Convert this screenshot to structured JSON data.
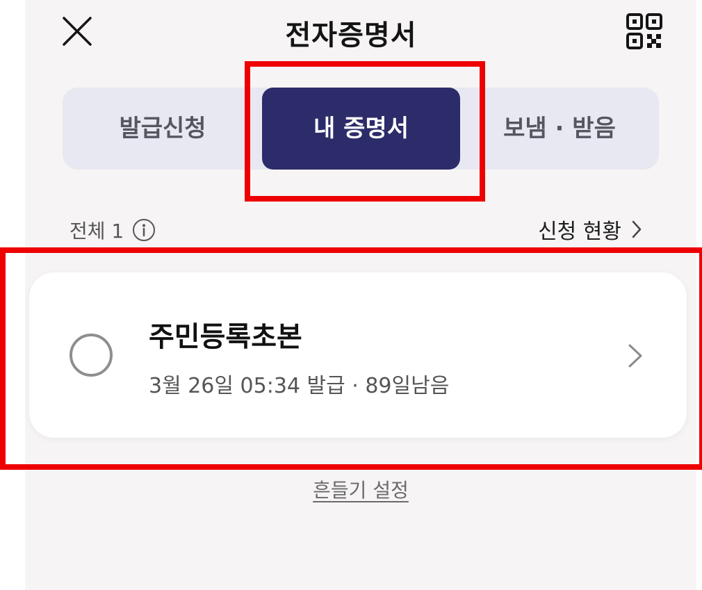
{
  "header": {
    "title": "전자증명서",
    "close_icon": "close-icon",
    "qr_icon": "qr-code-icon"
  },
  "tabs": [
    {
      "label": "발급신청",
      "selected": false
    },
    {
      "label": "내 증명서",
      "selected": true
    },
    {
      "label": "보냄 · 받음",
      "selected": false
    }
  ],
  "summary": {
    "count_label": "전체 1",
    "info_icon": "info-icon",
    "status_link": "신청 현황",
    "status_chevron_icon": "chevron-right-icon"
  },
  "certificates": [
    {
      "name": "주민등록초본",
      "detail": "3월 26일 05:34 발급 · 89일남음",
      "selected": false
    }
  ],
  "footer": {
    "shake_settings": "흔들기 설정"
  },
  "colors": {
    "background": "#f6f4f4",
    "tab_track": "#e7e8f1",
    "tab_active": "#2c2c6a",
    "highlight": "#ee0000"
  }
}
